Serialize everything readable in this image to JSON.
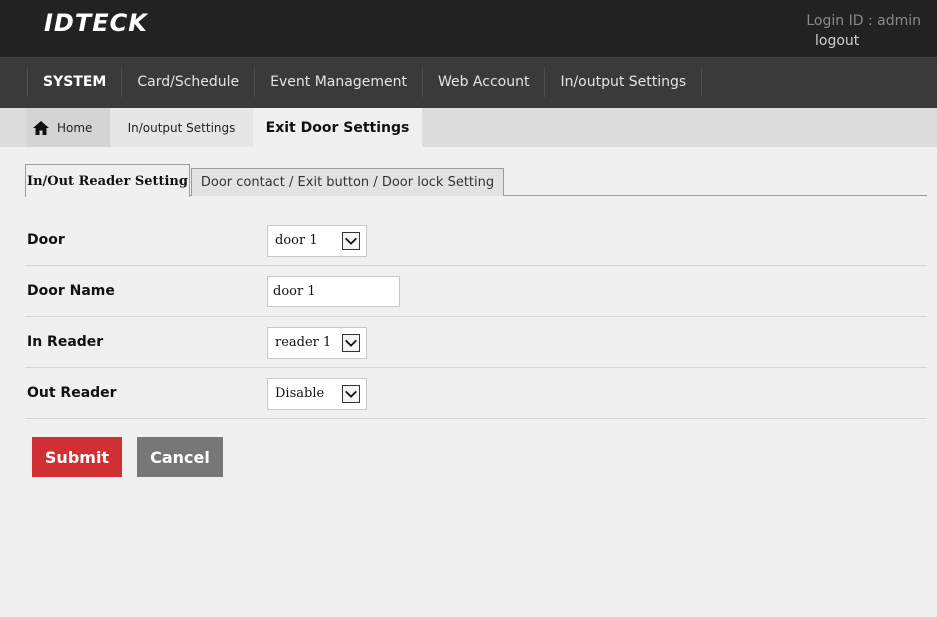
{
  "header": {
    "logo_text": "IDTECK",
    "login_id": "Login ID : admin",
    "logout": "logout"
  },
  "nav": {
    "items": [
      {
        "label": "SYSTEM",
        "active": true
      },
      {
        "label": "Card/Schedule",
        "active": false
      },
      {
        "label": "Event Management",
        "active": false
      },
      {
        "label": "Web Account",
        "active": false
      },
      {
        "label": "In/output Settings",
        "active": false
      }
    ]
  },
  "breadcrumb": {
    "home": "Home",
    "parent": "In/output Settings",
    "current": "Exit Door Settings",
    "home_icon": "home-icon"
  },
  "tabs": {
    "active": "In/Out Reader Setting",
    "inactive": "Door contact / Exit button / Door lock Setting"
  },
  "form": {
    "door": {
      "label": "Door",
      "value": "door 1"
    },
    "door_name": {
      "label": "Door Name",
      "value": "door 1"
    },
    "in_reader": {
      "label": "In Reader",
      "value": "reader 1"
    },
    "out_reader": {
      "label": "Out Reader",
      "value": "Disable"
    }
  },
  "buttons": {
    "submit": "Submit",
    "cancel": "Cancel"
  },
  "colors": {
    "topbar": "#222222",
    "nav": "#3a3a3a",
    "submit": "#d03033",
    "cancel": "#777777"
  }
}
